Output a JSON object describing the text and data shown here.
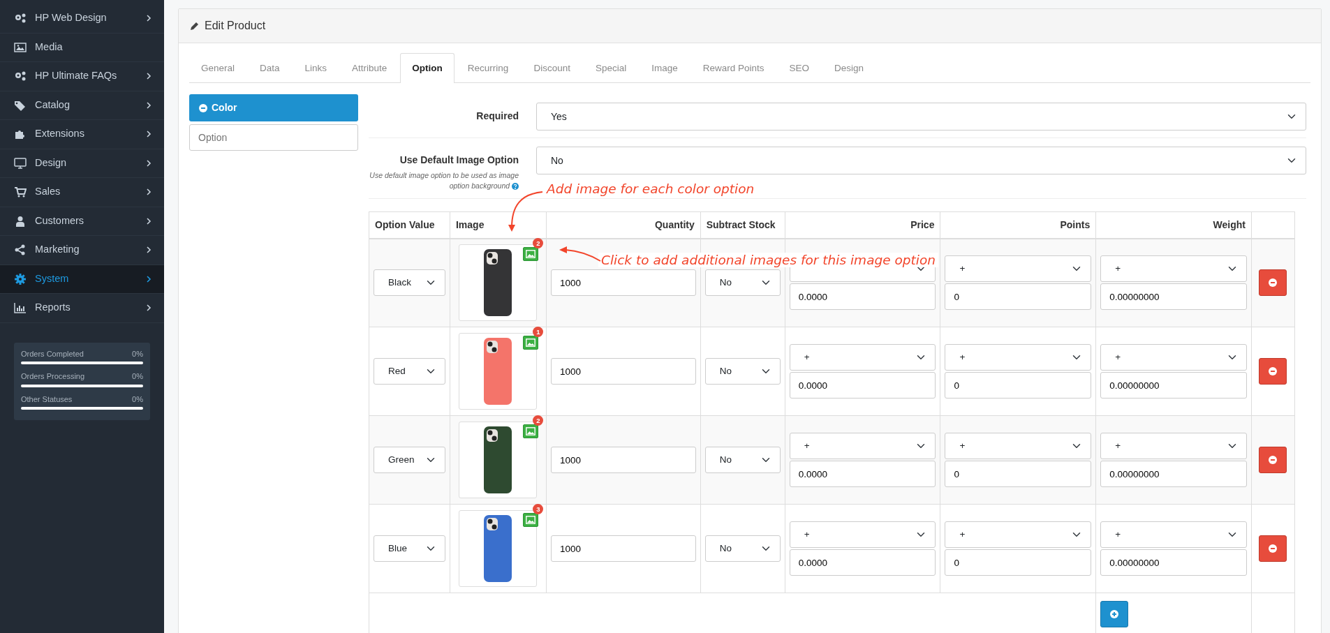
{
  "sidebar": {
    "items": [
      {
        "label": "HP Web Design",
        "expandable": true,
        "selected": false
      },
      {
        "label": "Media",
        "expandable": false,
        "selected": false
      },
      {
        "label": "HP Ultimate FAQs",
        "expandable": true,
        "selected": false
      },
      {
        "label": "Catalog",
        "expandable": true,
        "selected": false
      },
      {
        "label": "Extensions",
        "expandable": true,
        "selected": false
      },
      {
        "label": "Design",
        "expandable": true,
        "selected": false
      },
      {
        "label": "Sales",
        "expandable": true,
        "selected": false
      },
      {
        "label": "Customers",
        "expandable": true,
        "selected": false
      },
      {
        "label": "Marketing",
        "expandable": true,
        "selected": false
      },
      {
        "label": "System",
        "expandable": true,
        "selected": true
      },
      {
        "label": "Reports",
        "expandable": true,
        "selected": false
      }
    ],
    "stats": [
      {
        "label": "Orders Completed",
        "value": "0%",
        "level": 0
      },
      {
        "label": "Orders Processing",
        "value": "0%",
        "level": 0
      },
      {
        "label": "Other Statuses",
        "value": "0%",
        "level": 0
      }
    ]
  },
  "panel": {
    "title": "Edit Product"
  },
  "tabs": [
    {
      "label": "General",
      "selected": false
    },
    {
      "label": "Data",
      "selected": false
    },
    {
      "label": "Links",
      "selected": false
    },
    {
      "label": "Attribute",
      "selected": false
    },
    {
      "label": "Option",
      "selected": true
    },
    {
      "label": "Recurring",
      "selected": false
    },
    {
      "label": "Discount",
      "selected": false
    },
    {
      "label": "Special",
      "selected": false
    },
    {
      "label": "Image",
      "selected": false
    },
    {
      "label": "Reward Points",
      "selected": false
    },
    {
      "label": "SEO",
      "selected": false
    },
    {
      "label": "Design",
      "selected": false
    }
  ],
  "options": [
    {
      "label": "Color",
      "selected": true
    }
  ],
  "option_search": {
    "placeholder": "Option"
  },
  "form": {
    "required": {
      "label": "Required",
      "value": "Yes"
    },
    "default_image": {
      "label": "Use Default Image Option",
      "help": "Use default image option to be used as image option background",
      "value": "No"
    }
  },
  "table": {
    "columns": [
      "Option Value",
      "Image",
      "Quantity",
      "Subtract Stock",
      "Price",
      "Points",
      "Weight"
    ],
    "rows": [
      {
        "option_value": "Black",
        "color": "#343436",
        "image_count": "2",
        "quantity": "1000",
        "subtract": "No",
        "points_prefix": "+",
        "price": "0.0000",
        "points": "0",
        "weight_prefix": "+",
        "weight": "0.00000000"
      },
      {
        "option_value": "Red",
        "color": "#f4746a",
        "image_count": "1",
        "quantity": "1000",
        "subtract": "No",
        "price_prefix": "+",
        "points_prefix": "+",
        "price": "0.0000",
        "points": "0",
        "weight_prefix": "+",
        "weight": "0.00000000"
      },
      {
        "option_value": "Green",
        "color": "#2e4a30",
        "image_count": "2",
        "quantity": "1000",
        "subtract": "No",
        "price_prefix": "+",
        "points_prefix": "+",
        "price": "0.0000",
        "points": "0",
        "weight_prefix": "+",
        "weight": "0.00000000"
      },
      {
        "option_value": "Blue",
        "color": "#3a6fcc",
        "image_count": "3",
        "quantity": "1000",
        "subtract": "No",
        "price_prefix": "+",
        "points_prefix": "+",
        "price": "0.0000",
        "points": "0",
        "weight_prefix": "+",
        "weight": "0.00000000"
      }
    ]
  },
  "annotations": [
    {
      "text": "Add image for each color option"
    },
    {
      "text": "Click to add additional images for this image option"
    }
  ]
}
